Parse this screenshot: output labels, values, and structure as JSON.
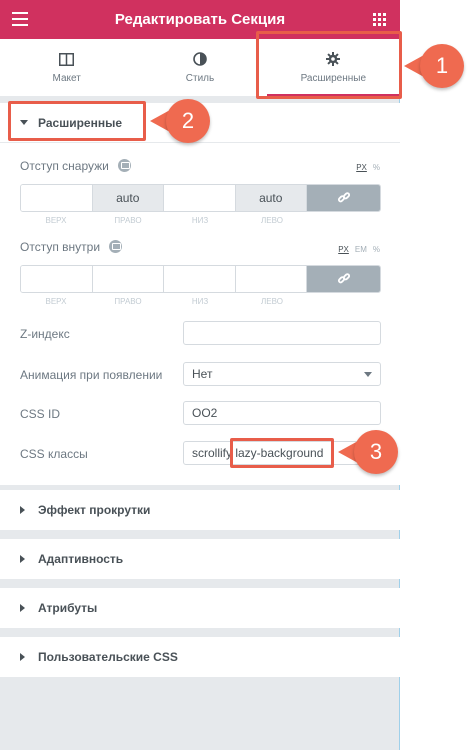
{
  "header": {
    "title": "Редактировать Секция"
  },
  "tabs": [
    {
      "label": "Макет",
      "icon": "layout-icon"
    },
    {
      "label": "Стиль",
      "icon": "contrast-icon"
    },
    {
      "label": "Расширенные",
      "icon": "gear-icon"
    }
  ],
  "section": {
    "title": "Расширенные"
  },
  "margin": {
    "label": "Отступ снаружи",
    "units": [
      "PX",
      "%"
    ],
    "values": [
      "",
      "auto",
      "",
      "auto"
    ],
    "captions": [
      "ВЕРХ",
      "ПРАВО",
      "НИЗ",
      "ЛЕВО"
    ]
  },
  "padding": {
    "label": "Отступ внутри",
    "units": [
      "PX",
      "EM",
      "%"
    ],
    "values": [
      "",
      "",
      "",
      ""
    ],
    "captions": [
      "ВЕРХ",
      "ПРАВО",
      "НИЗ",
      "ЛЕВО"
    ]
  },
  "fields": {
    "zindex_label": "Z-индекс",
    "zindex_value": "",
    "animation_label": "Анимация при появлении",
    "animation_value": "Нет",
    "cssid_label": "CSS ID",
    "cssid_value": "OO2",
    "cssclasses_label": "CSS классы",
    "cssclasses_value": "scrollify lazy-background"
  },
  "collapsed_sections": [
    "Эффект прокрутки",
    "Адаптивность",
    "Атрибуты",
    "Пользовательские CSS"
  ],
  "annotations": [
    "1",
    "2",
    "3"
  ],
  "colors": {
    "brand": "#d0315f",
    "annotation": "#ef6a50"
  }
}
